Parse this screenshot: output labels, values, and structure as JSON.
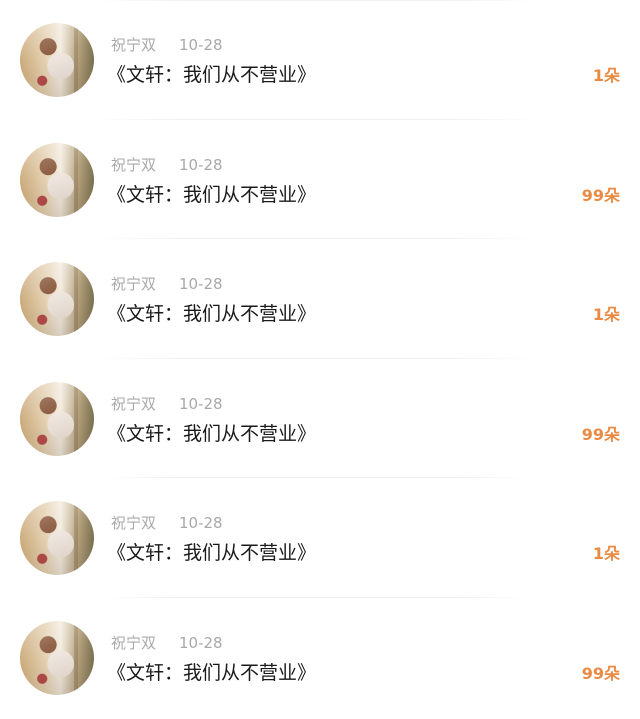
{
  "accent_color": "#ea8a43",
  "items": [
    {
      "name": "祝宁双",
      "date": "10-28",
      "title": "《文轩：我们从不营业》",
      "count": "1朵"
    },
    {
      "name": "祝宁双",
      "date": "10-28",
      "title": "《文轩：我们从不营业》",
      "count": "99朵"
    },
    {
      "name": "祝宁双",
      "date": "10-28",
      "title": "《文轩：我们从不营业》",
      "count": "1朵"
    },
    {
      "name": "祝宁双",
      "date": "10-28",
      "title": "《文轩：我们从不营业》",
      "count": "99朵"
    },
    {
      "name": "祝宁双",
      "date": "10-28",
      "title": "《文轩：我们从不营业》",
      "count": "1朵"
    },
    {
      "name": "祝宁双",
      "date": "10-28",
      "title": "《文轩：我们从不营业》",
      "count": "99朵"
    }
  ]
}
